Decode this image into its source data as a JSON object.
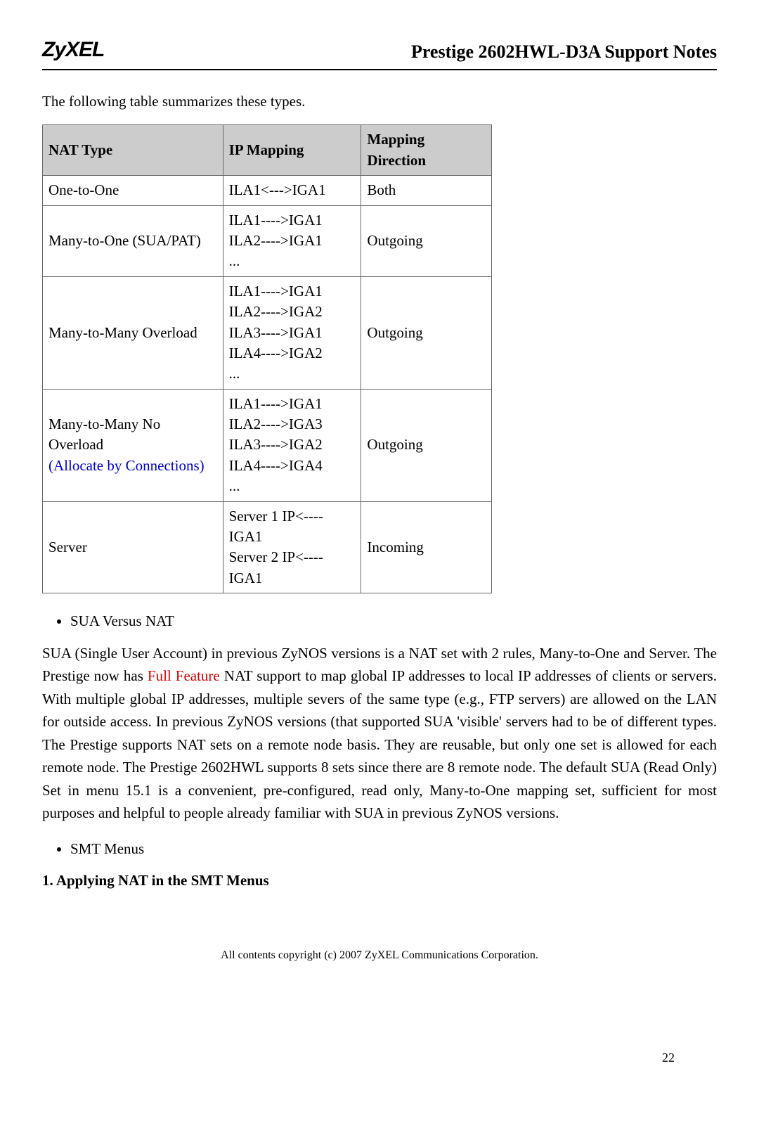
{
  "header": {
    "logo": "ZyXEL",
    "title": "Prestige 2602HWL-D3A Support Notes"
  },
  "intro": "The following table summarizes these types.",
  "table": {
    "headers": {
      "c1": "NAT Type",
      "c2": "IP Mapping",
      "c3": "Mapping Direction"
    },
    "rows": [
      {
        "type": "One-to-One",
        "mapping": "ILA1<--->IGA1",
        "dir": "Both"
      },
      {
        "type": "Many-to-One (SUA/PAT)",
        "mapping": "ILA1---->IGA1\nILA2---->IGA1\n...",
        "dir": "Outgoing"
      },
      {
        "type": "Many-to-Many Overload",
        "mapping": "ILA1---->IGA1\nILA2---->IGA2\nILA3---->IGA1\nILA4---->IGA2\n...",
        "dir": "Outgoing"
      },
      {
        "type_pre": "Many-to-Many No Overload",
        "type_link": "(Allocate by Connections)",
        "mapping": "ILA1---->IGA1\nILA2---->IGA3\nILA3---->IGA2\nILA4---->IGA4\n...",
        "dir": "Outgoing"
      },
      {
        "type": "Server",
        "mapping": "Server 1 IP<----IGA1\nServer 2 IP<----IGA1",
        "dir": "Incoming"
      }
    ]
  },
  "bullet1": "SUA Versus NAT",
  "para_pre": "SUA (Single User Account) in previous ZyNOS versions is a NAT set with 2 rules, Many-to-One and Server. The Prestige now has ",
  "para_red": "Full Feature",
  "para_post": " NAT support to map global IP addresses to local IP addresses of clients or servers. With multiple global IP addresses, multiple severs of the same type (e.g., FTP servers) are allowed on the LAN for outside access. In previous ZyNOS versions (that supported SUA 'visible' servers had to be of different types. The Prestige supports NAT sets on a remote node basis. They are reusable, but only one set is allowed for each remote node. The Prestige 2602HWL supports 8 sets since there are 8 remote node. The default SUA (Read Only) Set in menu 15.1 is a convenient, pre-configured, read only, Many-to-One mapping set, sufficient for most purposes and helpful to people already familiar with SUA in previous ZyNOS versions.",
  "bullet2": "SMT Menus",
  "section": "1. Applying NAT in the SMT Menus",
  "footer": "All contents copyright (c) 2007 ZyXEL Communications Corporation.",
  "pagenum": "22"
}
